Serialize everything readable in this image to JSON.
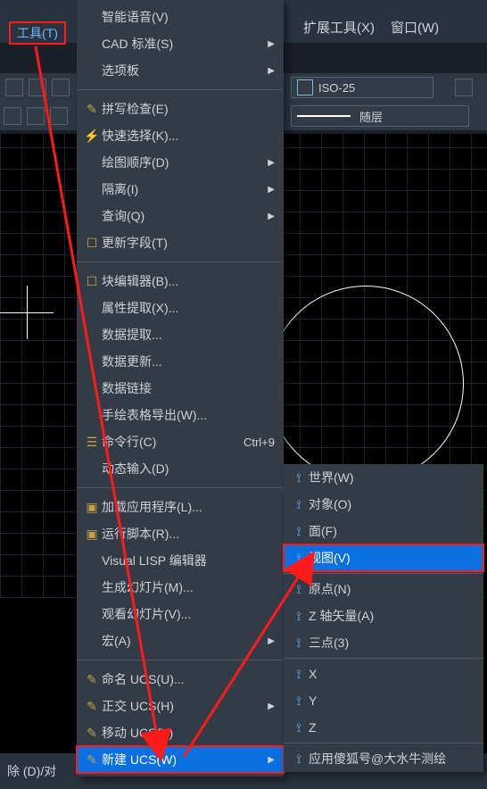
{
  "topbar": {
    "tools_label": "工具(T)",
    "other_menus": [
      "扩展工具(X)",
      "窗口(W)"
    ]
  },
  "toolrow": {
    "iso_label": "ISO-25",
    "layer_label": "随层"
  },
  "menu": {
    "top_items": [
      "智能语音(V)",
      "CAD 标准(S)",
      "选项板"
    ],
    "block1": [
      {
        "icon": "✎",
        "label": "拼写检查(E)"
      },
      {
        "icon": "⚡",
        "label": "快速选择(K)..."
      },
      {
        "icon": "",
        "label": "绘图顺序(D)",
        "arrow": true
      },
      {
        "icon": "",
        "label": "隔离(I)",
        "arrow": true
      },
      {
        "icon": "",
        "label": "查询(Q)",
        "arrow": true
      },
      {
        "icon": "☐",
        "label": "更新字段(T)"
      }
    ],
    "block2": [
      {
        "icon": "☐",
        "label": "块编辑器(B)..."
      },
      {
        "icon": "",
        "label": "属性提取(X)..."
      },
      {
        "icon": "",
        "label": "数据提取..."
      },
      {
        "icon": "",
        "label": "数据更新..."
      },
      {
        "icon": "",
        "label": "数据链接"
      },
      {
        "icon": "",
        "label": "手绘表格导出(W)..."
      },
      {
        "icon": "☰",
        "label": "命令行(C)",
        "shortcut": "Ctrl+9"
      },
      {
        "icon": "",
        "label": "动态输入(D)"
      }
    ],
    "block3": [
      {
        "icon": "▣",
        "label": "加载应用程序(L)..."
      },
      {
        "icon": "▣",
        "label": "运行脚本(R)..."
      },
      {
        "icon": "",
        "label": "Visual LISP 编辑器"
      },
      {
        "icon": "",
        "label": "生成幻灯片(M)..."
      },
      {
        "icon": "",
        "label": "观看幻灯片(V)..."
      },
      {
        "icon": "",
        "label": "宏(A)",
        "arrow": true
      }
    ],
    "block4": [
      {
        "icon": "✎",
        "label": "命名 UCS(U)..."
      },
      {
        "icon": "✎",
        "label": "正交 UCS(H)",
        "arrow": true
      },
      {
        "icon": "✎",
        "label": "移动 UCS(V)"
      },
      {
        "icon": "✎",
        "label": "新建 UCS(W)",
        "arrow": true,
        "hl": true,
        "redbox": true
      }
    ]
  },
  "submenu": {
    "items_top": [
      {
        "label": "世界(W)"
      },
      {
        "label": "对象(O)"
      },
      {
        "label": "面(F)"
      },
      {
        "label": "视图(V)",
        "hl": true,
        "redbox": true
      }
    ],
    "items_mid": [
      {
        "label": "原点(N)"
      },
      {
        "label": "Z 轴矢量(A)"
      },
      {
        "label": "三点(3)"
      }
    ],
    "items_axes": [
      {
        "label": "X"
      },
      {
        "label": "Y"
      },
      {
        "label": "Z"
      }
    ],
    "apply": "应用傻狐号@大水牛测绘"
  },
  "bottom_cmd": "除 (D)/对",
  "watermark": ""
}
